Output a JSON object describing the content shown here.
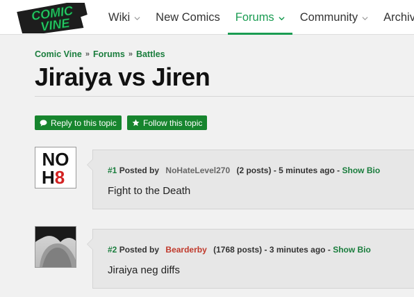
{
  "header": {
    "logo_text": "COMIC VINE",
    "nav": [
      {
        "label": "Wiki",
        "chevron": true
      },
      {
        "label": "New Comics",
        "chevron": false
      },
      {
        "label": "Forums",
        "chevron": true
      },
      {
        "label": "Community",
        "chevron": true
      },
      {
        "label": "Archive",
        "chevron": false
      }
    ]
  },
  "breadcrumb": {
    "items": [
      "Comic Vine",
      "Forums",
      "Battles"
    ],
    "separator": "»"
  },
  "page_title": "Jiraiya vs Jiren",
  "actions": {
    "reply_label": "Reply to this topic",
    "follow_label": "Follow this topic"
  },
  "posts": [
    {
      "number": "#1",
      "posted_by": "Posted by",
      "username": "NoHateLevel270",
      "username_color": "grey",
      "post_count": "(2 posts)",
      "time": "- 5 minutes ago -",
      "bio_link": "Show Bio",
      "body": "Fight to the Death",
      "avatar_text_top": "NO",
      "avatar_text_bottom": "H",
      "avatar_text_number": "8"
    },
    {
      "number": "#2",
      "posted_by": "Posted by",
      "username": "Bearderby",
      "username_color": "red",
      "post_count": "(1768 posts)",
      "time": "- 3 minutes ago -",
      "bio_link": "Show Bio",
      "body": "Jiraiya neg diffs"
    }
  ],
  "colors": {
    "accent": "#1a9c52",
    "link": "#1a7d3d",
    "button": "#17852e",
    "username_red": "#c0392b"
  }
}
